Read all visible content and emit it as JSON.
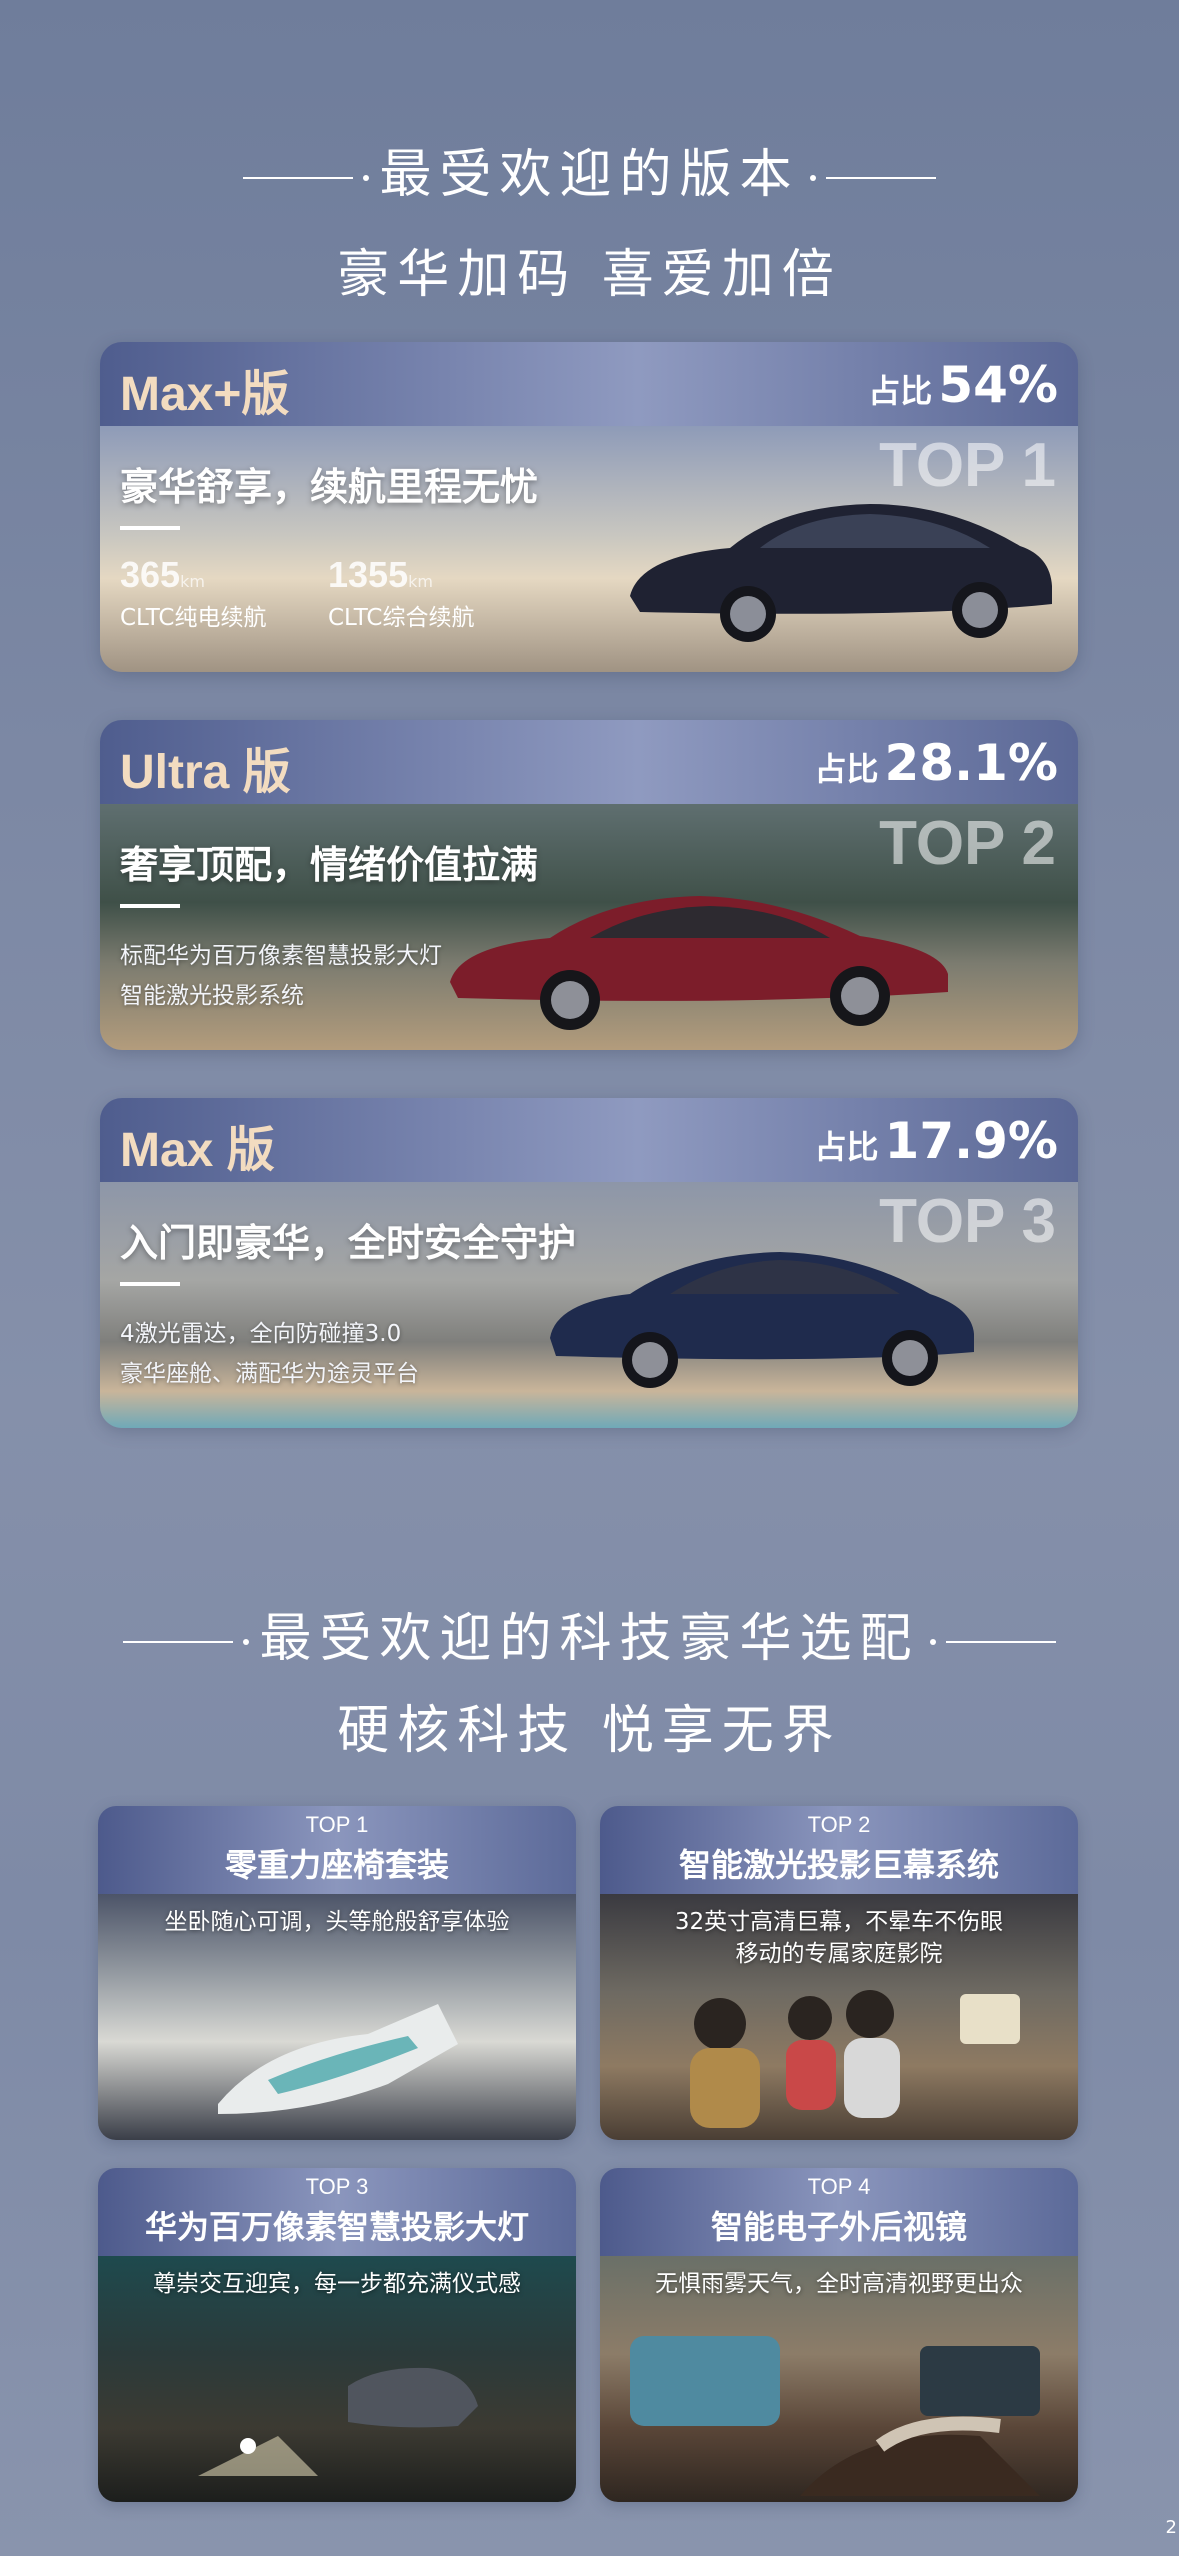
{
  "section1": {
    "title": "最受欢迎的版本",
    "subtitle": "豪华加码  喜爱加倍"
  },
  "versions": [
    {
      "name": "Max+版",
      "share_prefix": "占比",
      "share_value": "54%",
      "rank": "TOP 1",
      "slogan": "豪华舒享，续航里程无忧",
      "specs": [
        {
          "num": "365",
          "unit": "km",
          "label": "CLTC纯电续航"
        },
        {
          "num": "1355",
          "unit": "km",
          "label": "CLTC综合续航"
        }
      ]
    },
    {
      "name": "Ultra 版",
      "share_prefix": "占比",
      "share_value": "28.1%",
      "rank": "TOP 2",
      "slogan": "奢享顶配，情绪价值拉满",
      "lines": [
        "标配华为百万像素智慧投影大灯",
        "智能激光投影系统"
      ]
    },
    {
      "name": "Max 版",
      "share_prefix": "占比",
      "share_value": "17.9%",
      "rank": "TOP 3",
      "slogan": "入门即豪华，全时安全守护",
      "lines": [
        "4激光雷达，全向防碰撞3.0",
        "豪华座舱、满配华为途灵平台"
      ]
    }
  ],
  "section2": {
    "title": "最受欢迎的科技豪华选配",
    "subtitle": "硬核科技  悦享无界"
  },
  "options": [
    {
      "rank": "TOP 1",
      "title": "零重力座椅套装",
      "desc": [
        "坐卧随心可调，头等舱般舒享体验"
      ]
    },
    {
      "rank": "TOP 2",
      "title": "智能激光投影巨幕系统",
      "desc": [
        "32英寸高清巨幕，不晕车不伤眼",
        "移动的专属家庭影院"
      ]
    },
    {
      "rank": "TOP 3",
      "title": "华为百万像素智慧投影大灯",
      "desc": [
        "尊崇交互迎宾，每一步都充满仪式感"
      ]
    },
    {
      "rank": "TOP 4",
      "title": "智能电子外后视镜",
      "desc": [
        "无惧雨雾天气，全时高清视野更出众"
      ]
    }
  ],
  "corner_mark": "2"
}
